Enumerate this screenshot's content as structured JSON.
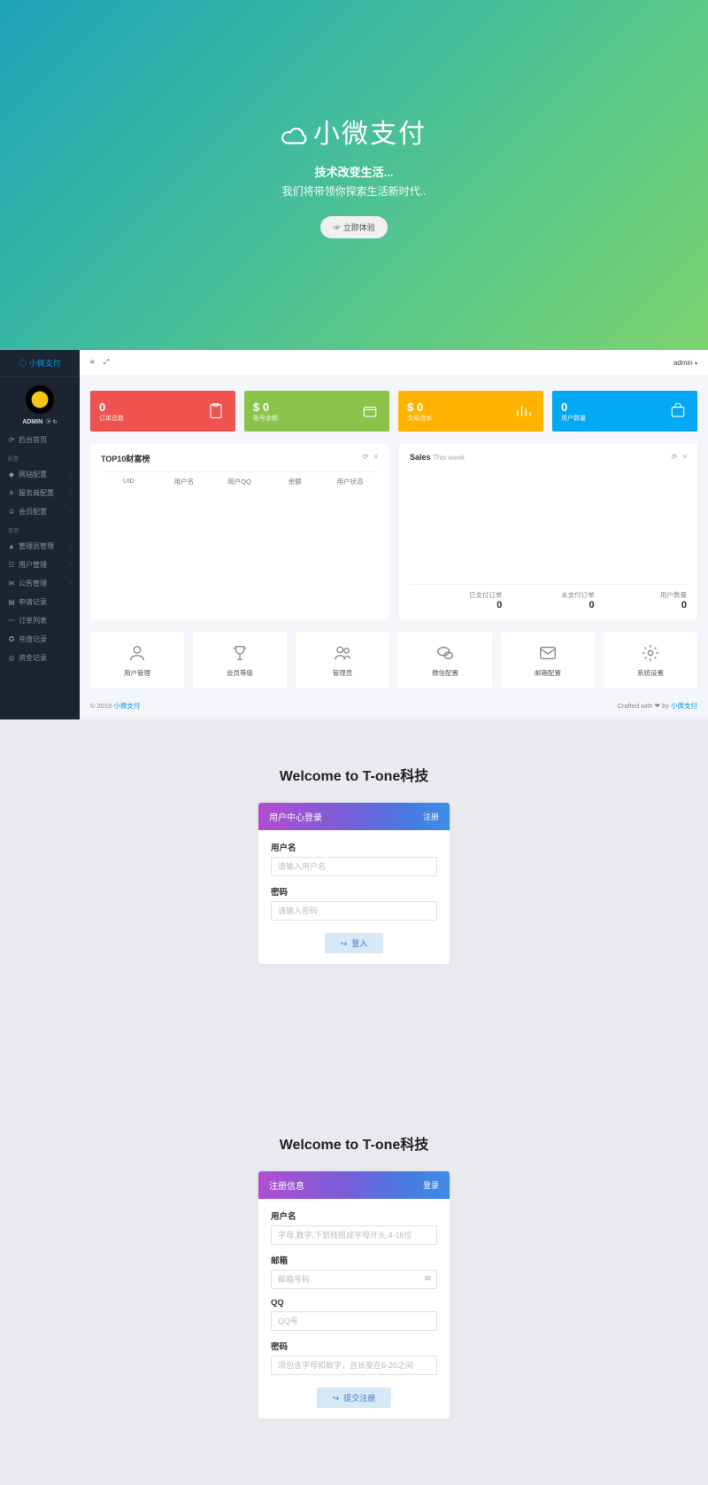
{
  "hero": {
    "title": "小微支付",
    "sub1": "技术改变生活...",
    "sub2": "我们将带领你探索生活新时代..",
    "btn": "☞ 立即体验"
  },
  "admin": {
    "brand": "◇ 小微支付",
    "user": "ADMIN",
    "nav_dashboard": "后台首页",
    "group_config": "配置",
    "group_manage": "管理",
    "items_cfg": [
      {
        "label": "网站配置",
        "expand": true
      },
      {
        "label": "服务商配置",
        "expand": true
      },
      {
        "label": "会员配置",
        "expand": true
      }
    ],
    "items_mgr": [
      {
        "label": "管理员管理",
        "expand": true
      },
      {
        "label": "用户管理",
        "expand": true
      },
      {
        "label": "公告管理",
        "expand": true
      },
      {
        "label": "申请记录",
        "expand": false
      },
      {
        "label": "订单列表",
        "expand": false
      },
      {
        "label": "充值记录",
        "expand": false
      },
      {
        "label": "资金记录",
        "expand": false
      }
    ],
    "topbar_user": "admin",
    "stats": [
      {
        "value": "0",
        "label": "订单总数",
        "color": "red"
      },
      {
        "value": "$ 0",
        "label": "账号余额",
        "color": "green"
      },
      {
        "value": "$ 0",
        "label": "交易流水",
        "color": "orange"
      },
      {
        "value": "0",
        "label": "用户数量",
        "color": "blue"
      }
    ],
    "wealth": {
      "title": "TOP10财富榜",
      "cols": [
        "UID",
        "用户名",
        "用户QQ",
        "余额",
        "用户状态"
      ]
    },
    "sales": {
      "title": "Sales",
      "sub": "This week",
      "foot": [
        {
          "label": "已支付订单",
          "value": "0"
        },
        {
          "label": "未支付订单",
          "value": "0"
        },
        {
          "label": "用户数量",
          "value": "0"
        }
      ]
    },
    "quick": [
      "用户管理",
      "会员等级",
      "管理员",
      "微信配置",
      "邮箱配置",
      "系统设置"
    ],
    "footerL": "© 2019 ",
    "footerLink": "小微支付",
    "footerR": "Crafted with ❤ by ",
    "footerRLink": "小微支付"
  },
  "login": {
    "welcome": "Welcome to T-one科技",
    "title": "用户中心登录",
    "link": "注册",
    "fields": [
      {
        "label": "用户名",
        "placeholder": "请输入用户名"
      },
      {
        "label": "密码",
        "placeholder": "请输入密码"
      }
    ],
    "btn": "登入"
  },
  "register": {
    "welcome": "Welcome to T-one科技",
    "title": "注册信息",
    "link": "登录",
    "fields": [
      {
        "label": "用户名",
        "placeholder": "字母,数字,下划线组成字母开头,4-16位"
      },
      {
        "label": "邮箱",
        "placeholder": "邮箱号码",
        "suffix": "✉"
      },
      {
        "label": "QQ",
        "placeholder": "QQ号"
      },
      {
        "label": "密码",
        "placeholder": "须包含字母和数字，且长度在6-20之间"
      }
    ],
    "btn": "提交注册"
  }
}
